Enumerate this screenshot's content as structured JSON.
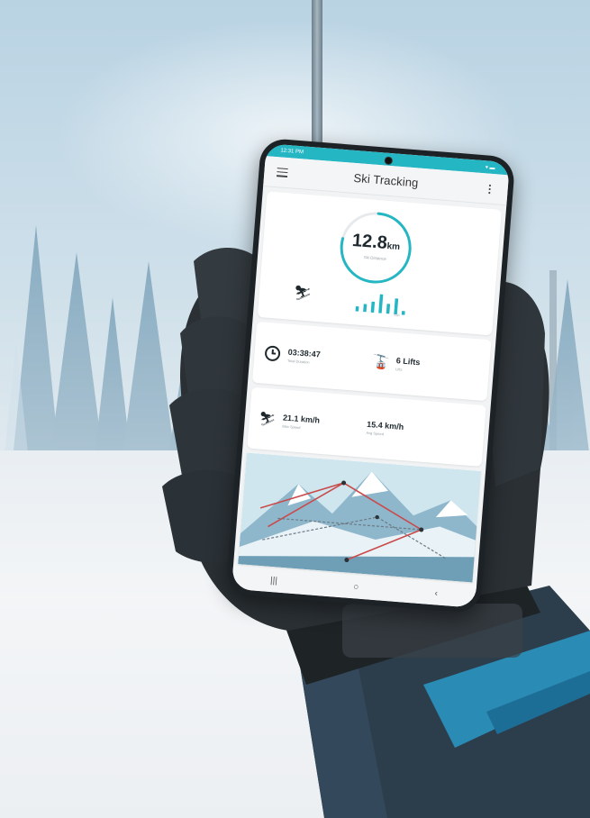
{
  "app": {
    "title": "Ski Tracking",
    "status_time": "12:31 PM"
  },
  "distance": {
    "value": "12.8",
    "unit": "km",
    "caption": "Ski Distance",
    "progress_fraction": 0.78
  },
  "stats": {
    "duration": {
      "value": "03:38:47",
      "label": "Total Duration"
    },
    "lifts": {
      "value": "6 Lifts",
      "label": "Lifts"
    },
    "max_speed": {
      "value": "21.1 km/h",
      "label": "Max Speed"
    },
    "avg_speed": {
      "value": "15.4 km/h",
      "label": "Avg Speed"
    }
  },
  "activity_bars": {
    "values": [
      0.25,
      0.4,
      0.55,
      0.95,
      0.5,
      0.8,
      0.2
    ],
    "labels": [
      "",
      "",
      "",
      "",
      "Sun",
      ""
    ]
  },
  "icons": {
    "menu": "menu-icon",
    "more": "more-vert-icon",
    "skier": "skier-icon",
    "clock": "clock-icon",
    "lift": "chairlift-icon",
    "speed_skier": "downhill-skier-icon"
  },
  "nav": {
    "recents": "|||",
    "home": "○",
    "back": "‹"
  },
  "colors": {
    "accent": "#25b6c4",
    "route_red": "#c94a4a",
    "route_gray": "#6b7a84"
  }
}
